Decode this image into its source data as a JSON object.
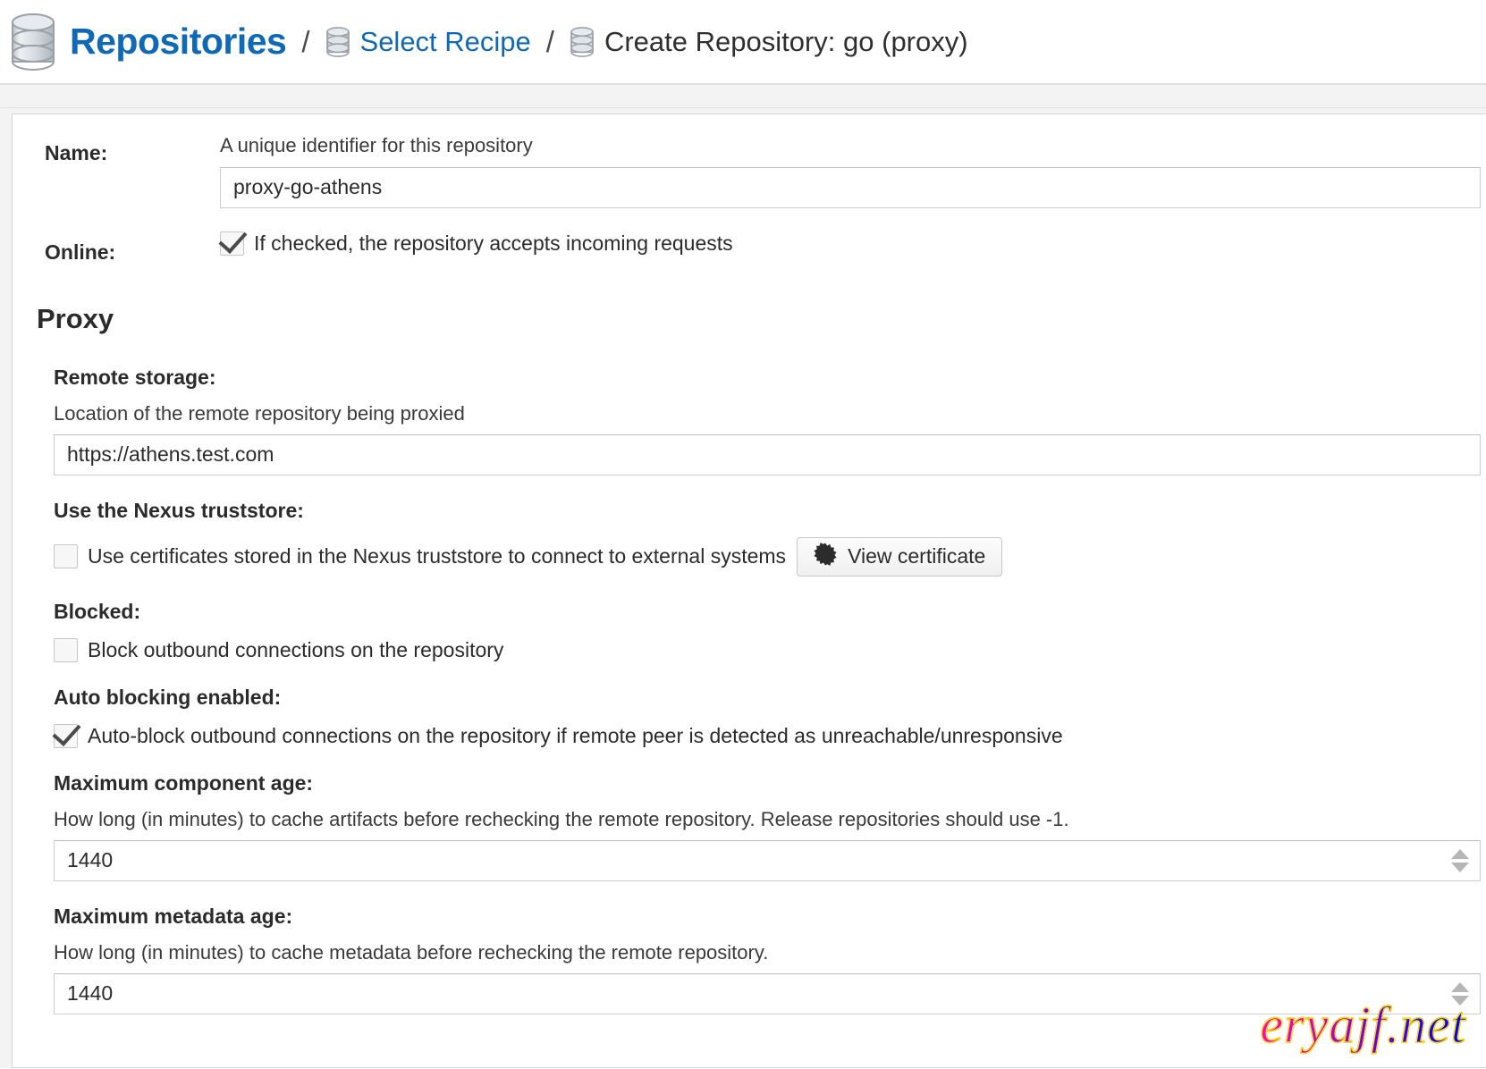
{
  "breadcrumb": {
    "root_label": "Repositories",
    "separator": "/",
    "link_label": "Select Recipe",
    "current_label": "Create Repository: go (proxy)",
    "root_icon": "database-icon",
    "link_icon": "database-icon",
    "current_icon": "database-icon",
    "link_color": "#1069b4"
  },
  "form": {
    "name": {
      "label": "Name:",
      "hint": "A unique identifier for this repository",
      "value": "proxy-go-athens",
      "placeholder": ""
    },
    "online": {
      "label": "Online:",
      "checkbox_label": "If checked, the repository accepts incoming requests",
      "checked": true
    }
  },
  "proxy": {
    "section_title": "Proxy",
    "remote_storage": {
      "label": "Remote storage:",
      "hint": "Location of the remote repository being proxied",
      "value": "https://athens.test.com",
      "placeholder": ""
    },
    "truststore": {
      "label": "Use the Nexus truststore:",
      "checkbox_label": "Use certificates stored in the Nexus truststore to connect to external systems",
      "checked": false,
      "button_label": "View certificate",
      "button_icon": "certificate-seal-icon"
    },
    "blocked": {
      "label": "Blocked:",
      "checkbox_label": "Block outbound connections on the repository",
      "checked": false
    },
    "auto_blocking": {
      "label": "Auto blocking enabled:",
      "checkbox_label": "Auto-block outbound connections on the repository if remote peer is detected as unreachable/unresponsive",
      "checked": true
    },
    "max_component_age": {
      "label": "Maximum component age:",
      "hint": "How long (in minutes) to cache artifacts before rechecking the remote repository. Release repositories should use -1.",
      "value": "1440",
      "placeholder": ""
    },
    "max_metadata_age": {
      "label": "Maximum metadata age:",
      "hint": "How long (in minutes) to cache metadata before rechecking the remote repository.",
      "value": "1440",
      "placeholder": ""
    }
  },
  "watermark": {
    "text": "eryajf.net"
  }
}
